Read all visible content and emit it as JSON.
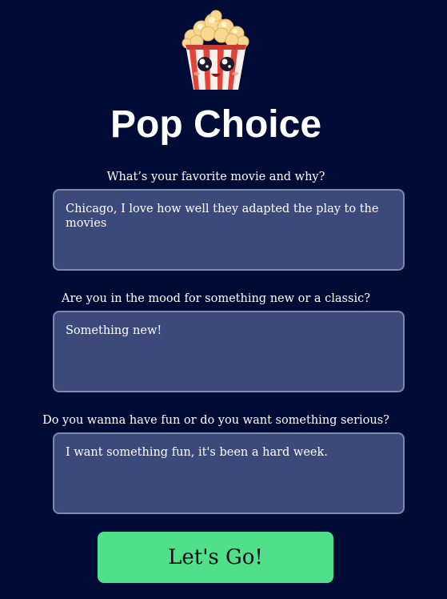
{
  "app": {
    "title": "Pop Choice",
    "logo_icon": "popcorn-icon"
  },
  "colors": {
    "background": "#000c36",
    "field_background": "#3b4a7a",
    "field_border": "#7e88a8",
    "button_background": "#51e08a"
  },
  "form": {
    "questions": [
      {
        "label": "What’s your favorite movie and why?",
        "value": "Chicago, I love how well they adapted the play to the movies"
      },
      {
        "label": "Are you in the mood for something new or a classic?",
        "value": "Something new!"
      },
      {
        "label": "Do you wanna have fun or do you want something serious?",
        "value": "I want something fun, it's been a hard week."
      }
    ],
    "submit_label": "Let's Go!"
  }
}
